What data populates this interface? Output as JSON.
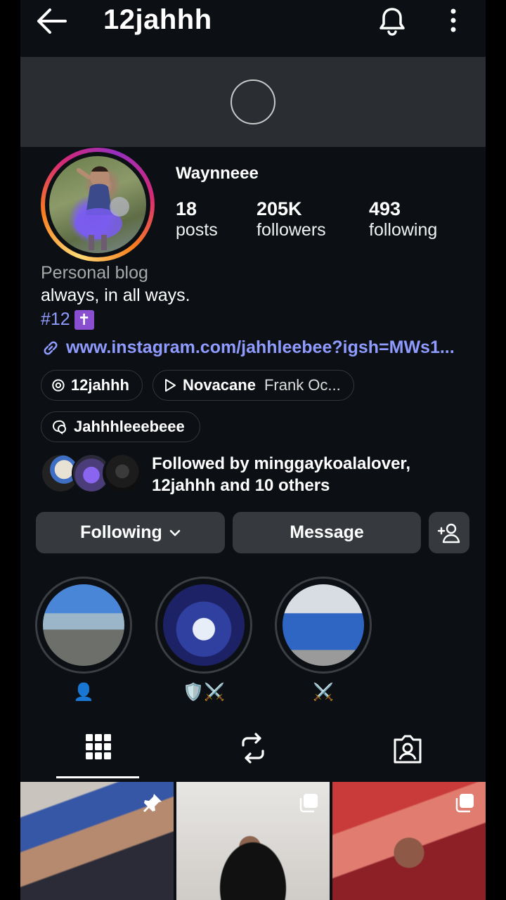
{
  "header": {
    "username": "12jahhh",
    "back_icon": "arrow-left-icon",
    "bell_icon": "bell-icon",
    "more_icon": "more-vertical-icon"
  },
  "profile": {
    "display_name": "Waynneee",
    "stats": [
      {
        "value": "18",
        "label": "posts"
      },
      {
        "value": "205K",
        "label": "followers"
      },
      {
        "value": "493",
        "label": "following"
      }
    ],
    "category": "Personal blog",
    "bio_line": "always, in all ways.",
    "bio_tag": "#12",
    "bio_tag_emoji": "✝️",
    "link": "www.instagram.com/jahhleebee?igsh=MWs1...",
    "threads_handle": "12jahhh",
    "music_title": "Novacane",
    "music_artist": "Frank Oc...",
    "channel_name": "Jahhhleeebeee",
    "followed_by": "Followed by minggaykoalalover, 12jahhh and 10 others"
  },
  "actions": {
    "following_label": "Following",
    "message_label": "Message"
  },
  "highlights": [
    {
      "label": "👤"
    },
    {
      "label": "🛡️⚔️"
    },
    {
      "label": "⚔️"
    }
  ],
  "tabs": [
    "grid-icon",
    "reels-repost-icon",
    "tagged-icon"
  ],
  "colors": {
    "background": "#0c1014",
    "link": "#8f9bff",
    "button": "#363a3f"
  }
}
